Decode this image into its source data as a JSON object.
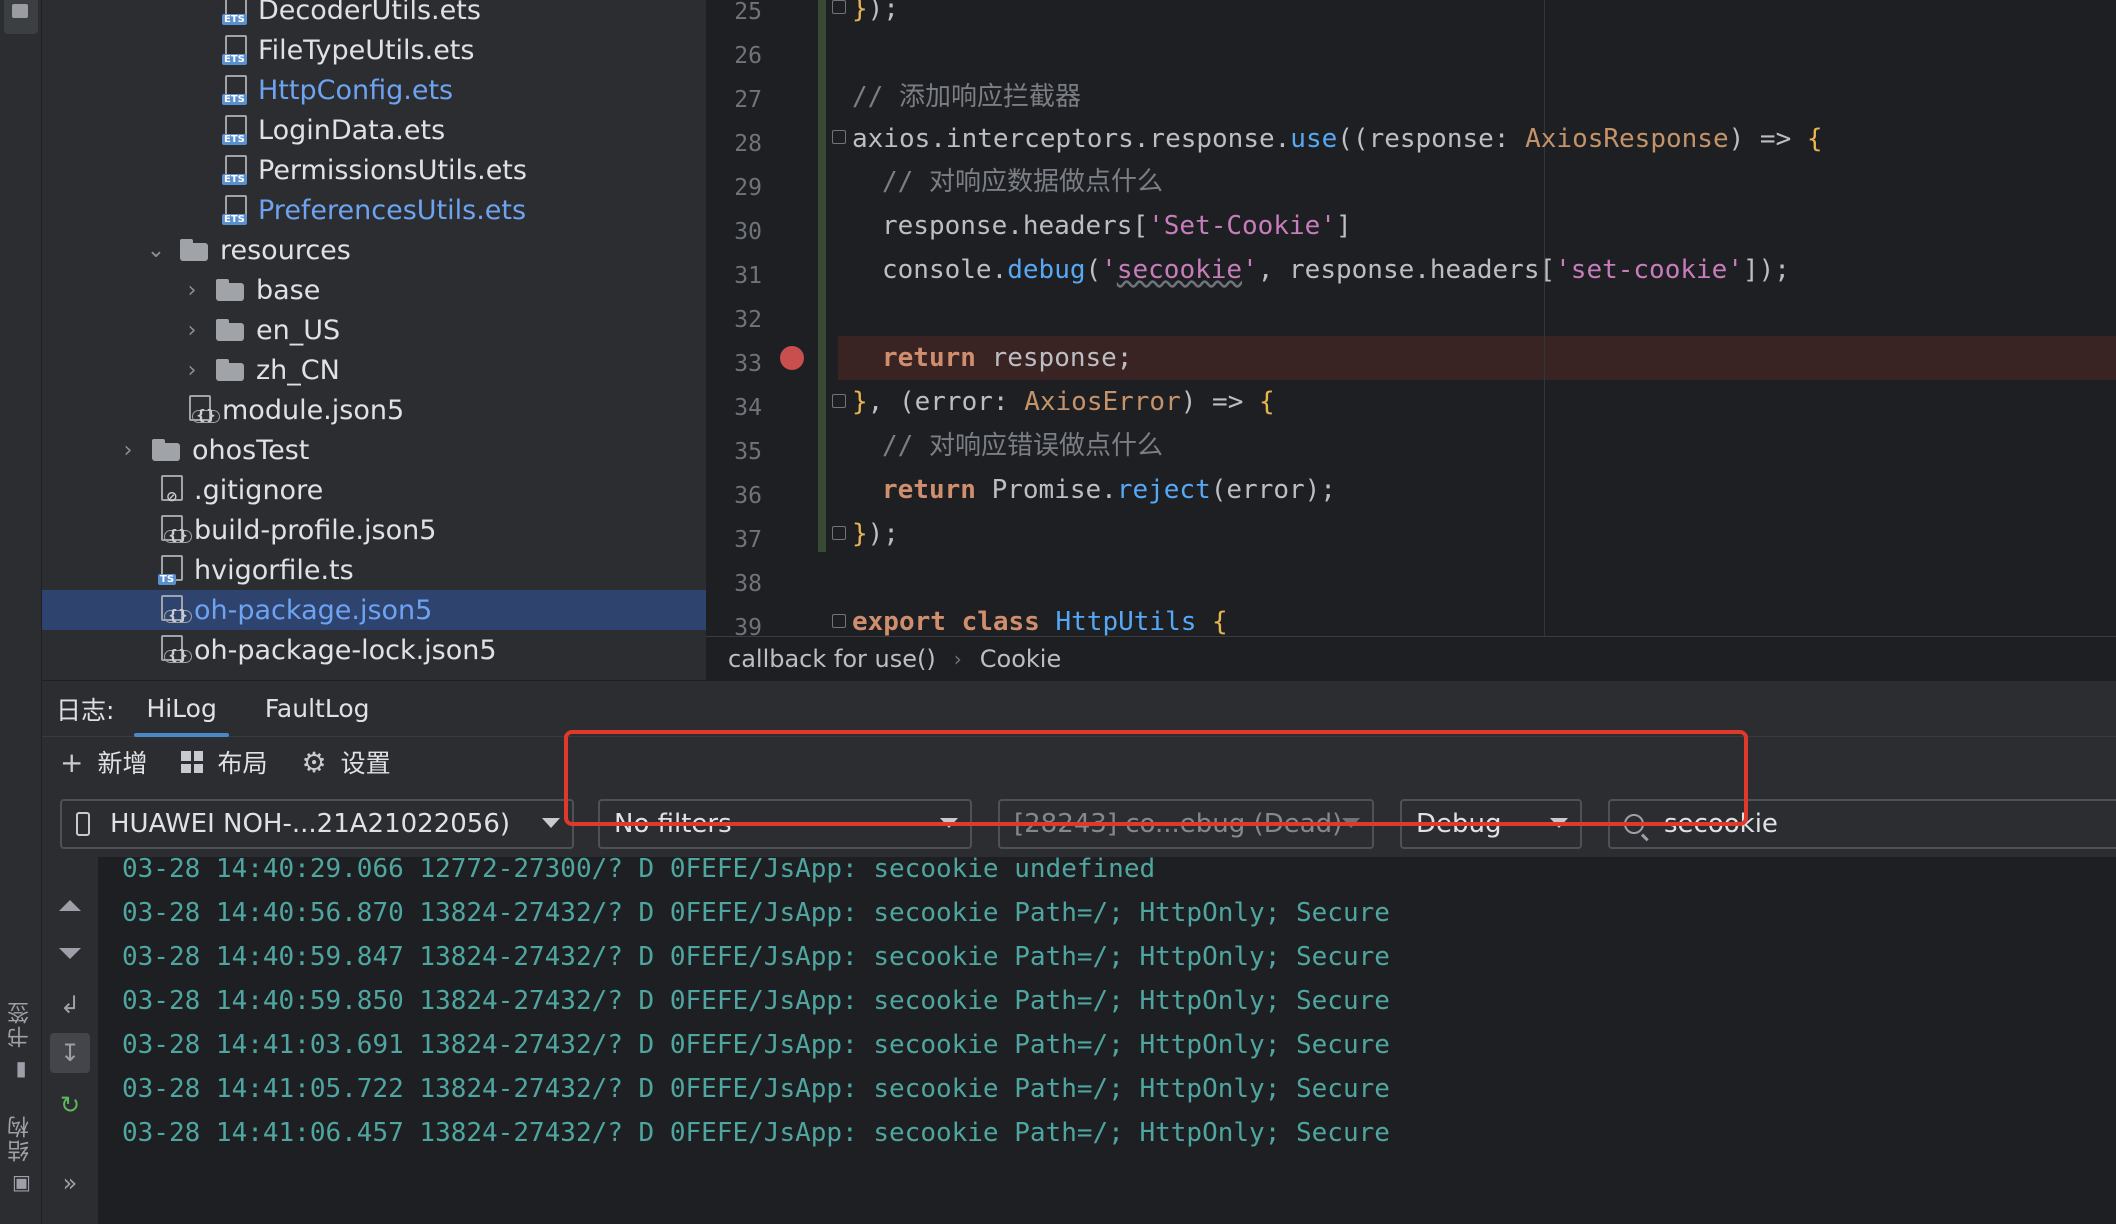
{
  "left_strip": {
    "bookmarks_label": "书签",
    "structure_label": "结构"
  },
  "project_tree": {
    "items": [
      {
        "name": "DecoderUtils.ets",
        "kind": "ets",
        "level": 3
      },
      {
        "name": "FileTypeUtils.ets",
        "kind": "ets",
        "level": 3
      },
      {
        "name": "HttpConfig.ets",
        "kind": "ets",
        "level": 3,
        "modified": true
      },
      {
        "name": "LoginData.ets",
        "kind": "ets",
        "level": 3
      },
      {
        "name": "PermissionsUtils.ets",
        "kind": "ets",
        "level": 3
      },
      {
        "name": "PreferencesUtils.ets",
        "kind": "ets",
        "level": 3,
        "modified": true
      },
      {
        "name": "resources",
        "kind": "folder-open",
        "level": 2
      },
      {
        "name": "base",
        "kind": "folder",
        "level": 3
      },
      {
        "name": "en_US",
        "kind": "folder",
        "level": 3
      },
      {
        "name": "zh_CN",
        "kind": "folder",
        "level": 3
      },
      {
        "name": "module.json5",
        "kind": "json",
        "level": 2
      },
      {
        "name": "ohosTest",
        "kind": "folder",
        "level": 1
      },
      {
        "name": ".gitignore",
        "kind": "git",
        "level": 1
      },
      {
        "name": "build-profile.json5",
        "kind": "json",
        "level": 1
      },
      {
        "name": "hvigorfile.ts",
        "kind": "ts",
        "level": 1
      },
      {
        "name": "oh-package.json5",
        "kind": "json",
        "level": 1,
        "selected": true
      },
      {
        "name": "oh-package-lock.json5",
        "kind": "json",
        "level": 1
      }
    ]
  },
  "editor": {
    "line_numbers": [
      "25",
      "26",
      "27",
      "28",
      "29",
      "30",
      "31",
      "32",
      "33",
      "34",
      "35",
      "36",
      "37",
      "38",
      "39"
    ],
    "breakpoint_line": "33",
    "breadcrumb": [
      "callback for use()",
      "Cookie"
    ]
  },
  "log": {
    "title": "日志:",
    "tabs": [
      "HiLog",
      "FaultLog"
    ],
    "active_tab": "HiLog",
    "toolbar": {
      "add": "新增",
      "layout": "布局",
      "settings": "设置"
    },
    "device": "HUAWEI NOH-...21A21022056)",
    "filter": "No filters",
    "process": "[28243] co...ebug (Dead)",
    "level": "Debug",
    "search": "secookie",
    "lines": [
      "03-28 14:40:29.066 12772-27300/? D 0FEFE/JsApp: secookie undefined",
      "03-28 14:40:56.870 13824-27432/? D 0FEFE/JsApp: secookie Path=/; HttpOnly; Secure",
      "03-28 14:40:59.847 13824-27432/? D 0FEFE/JsApp: secookie Path=/; HttpOnly; Secure",
      "03-28 14:40:59.850 13824-27432/? D 0FEFE/JsApp: secookie Path=/; HttpOnly; Secure",
      "03-28 14:41:03.691 13824-27432/? D 0FEFE/JsApp: secookie Path=/; HttpOnly; Secure",
      "03-28 14:41:05.722 13824-27432/? D 0FEFE/JsApp: secookie Path=/; HttpOnly; Secure",
      "03-28 14:41:06.457 13824-27432/? D 0FEFE/JsApp: secookie Path=/; HttpOnly; Secure"
    ]
  },
  "colors": {
    "accent": "#4a88c7",
    "highlight_box": "#e0382b",
    "log_text": "#4fa6a0",
    "selected_row": "#2e436e"
  }
}
